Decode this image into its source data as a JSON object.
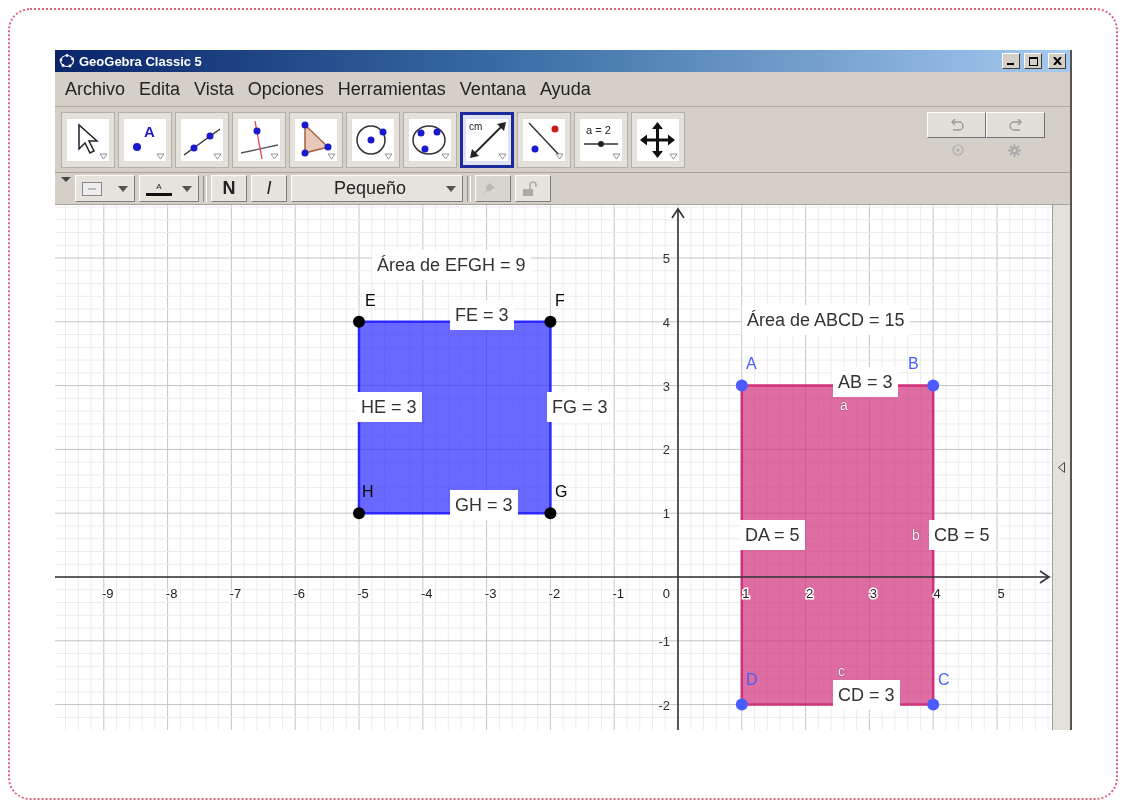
{
  "window": {
    "title": "GeoGebra Classic 5"
  },
  "menu": [
    "Archivo",
    "Edita",
    "Vista",
    "Opciones",
    "Herramientas",
    "Ventana",
    "Ayuda"
  ],
  "toolbar": {
    "tools": [
      {
        "kind": "move",
        "selected": false
      },
      {
        "kind": "point",
        "caption": "A",
        "selected": false
      },
      {
        "kind": "line",
        "selected": false
      },
      {
        "kind": "perpendicular",
        "selected": false
      },
      {
        "kind": "polygon",
        "selected": false
      },
      {
        "kind": "circle",
        "selected": false
      },
      {
        "kind": "conic",
        "selected": false
      },
      {
        "kind": "distance",
        "caption": "cm",
        "selected": true
      },
      {
        "kind": "reflect",
        "selected": false
      },
      {
        "kind": "slider",
        "caption": "a = 2",
        "selected": false
      },
      {
        "kind": "pan",
        "selected": false
      }
    ]
  },
  "style_bar": {
    "color_caption": "A",
    "bold": "N",
    "italic": "I",
    "font_size": "Pequeño",
    "pin_disabled": true
  },
  "graphics": {
    "x_axis_labels": [
      "-9",
      "-8",
      "-7",
      "-6",
      "-5",
      "-4",
      "-3",
      "-2",
      "-1",
      "0",
      "1",
      "2",
      "3",
      "4",
      "5"
    ],
    "y_axis_labels": [
      "5",
      "4",
      "3",
      "2",
      "1",
      "-1",
      "-2"
    ],
    "polygons": [
      {
        "color": "#2a2aff",
        "area": "Área de EFGH = 9",
        "vertices": [
          {
            "label": "E",
            "color": "#000000"
          },
          {
            "label": "F",
            "color": "#000000"
          },
          {
            "label": "H",
            "color": "#000000"
          },
          {
            "label": "G",
            "color": "#000000"
          }
        ],
        "side_labels": [
          "FE = 3",
          "FG = 3",
          "GH = 3",
          "HE = 3"
        ]
      },
      {
        "color": "#d0307a",
        "area": "Área de ABCD = 15",
        "vertices": [
          {
            "label": "A",
            "color": "#4a5cff"
          },
          {
            "label": "B",
            "color": "#4a5cff"
          },
          {
            "label": "D",
            "color": "#4a5cff"
          },
          {
            "label": "C",
            "color": "#4a5cff"
          }
        ],
        "side_labels": [
          "AB = 3",
          "CB = 5",
          "CD = 3",
          "DA = 5"
        ],
        "side_names": [
          "a",
          "b",
          "c"
        ]
      }
    ]
  }
}
